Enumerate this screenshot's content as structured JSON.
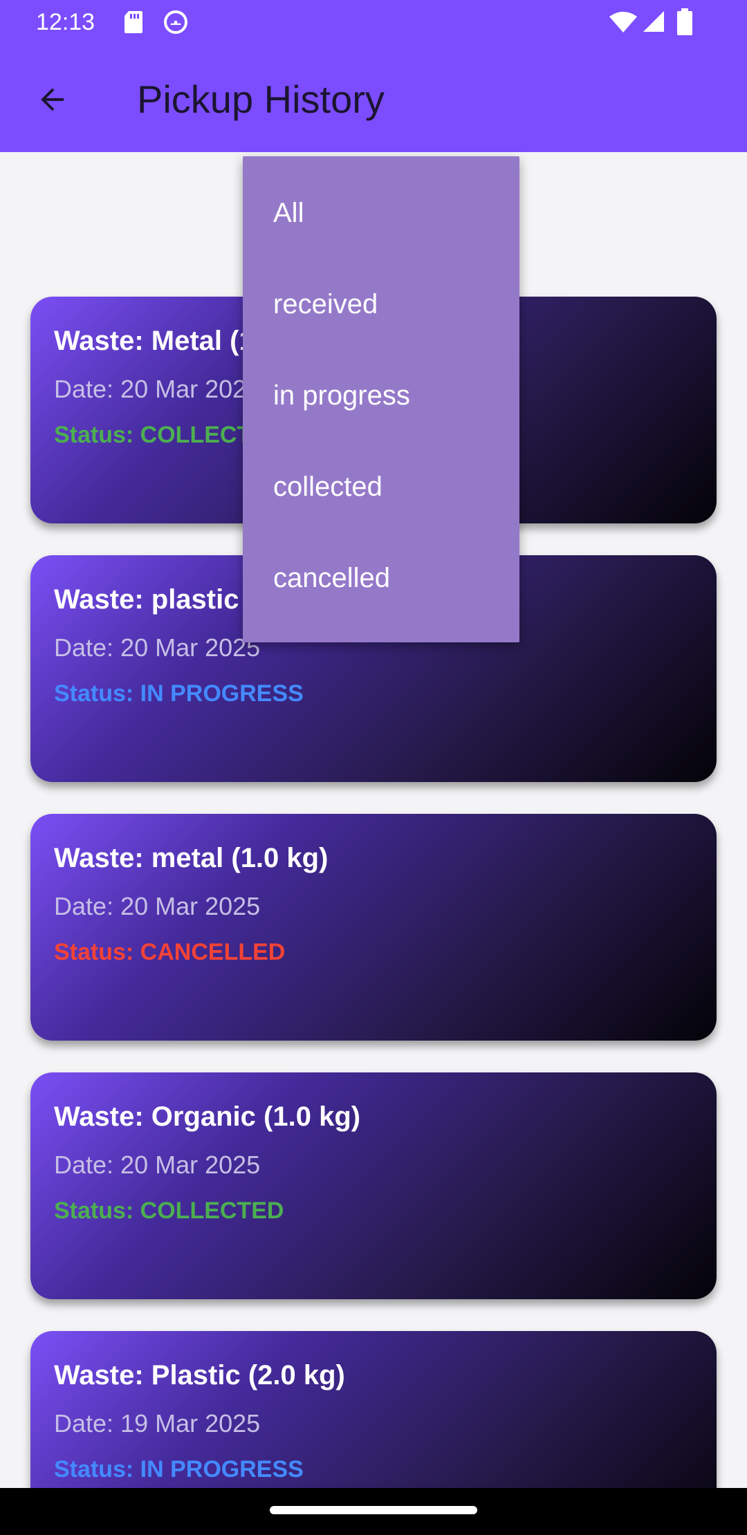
{
  "status_bar": {
    "time": "12:13",
    "icons": [
      "sd-card-icon",
      "android-debug-icon",
      "wifi-icon",
      "signal-icon",
      "battery-icon"
    ]
  },
  "app_bar": {
    "title": "Pickup History",
    "back_icon": "arrow-back-icon"
  },
  "dropdown": {
    "options": [
      "All",
      "received",
      "in progress",
      "collected",
      "cancelled"
    ]
  },
  "pickups": [
    {
      "waste": "Waste: Metal (1.0 kg)",
      "date": "Date: 20 Mar 2025",
      "status": "Status: COLLECTED",
      "status_type": "collected"
    },
    {
      "waste": "Waste: plastic (1.0 kg)",
      "date": "Date: 20 Mar 2025",
      "status": "Status: IN PROGRESS",
      "status_type": "inprogress"
    },
    {
      "waste": "Waste: metal (1.0 kg)",
      "date": "Date: 20 Mar 2025",
      "status": "Status: CANCELLED",
      "status_type": "cancelled"
    },
    {
      "waste": "Waste: Organic (1.0 kg)",
      "date": "Date: 20 Mar 2025",
      "status": "Status: COLLECTED",
      "status_type": "collected"
    },
    {
      "waste": "Waste: Plastic (2.0 kg)",
      "date": "Date: 19 Mar 2025",
      "status": "Status: IN PROGRESS",
      "status_type": "inprogress"
    }
  ],
  "colors": {
    "app_bar": "#7c4dff",
    "collected": "#4caf50",
    "in_progress": "#448aff",
    "cancelled": "#f44336",
    "dropdown_bg": "#9579c9"
  }
}
